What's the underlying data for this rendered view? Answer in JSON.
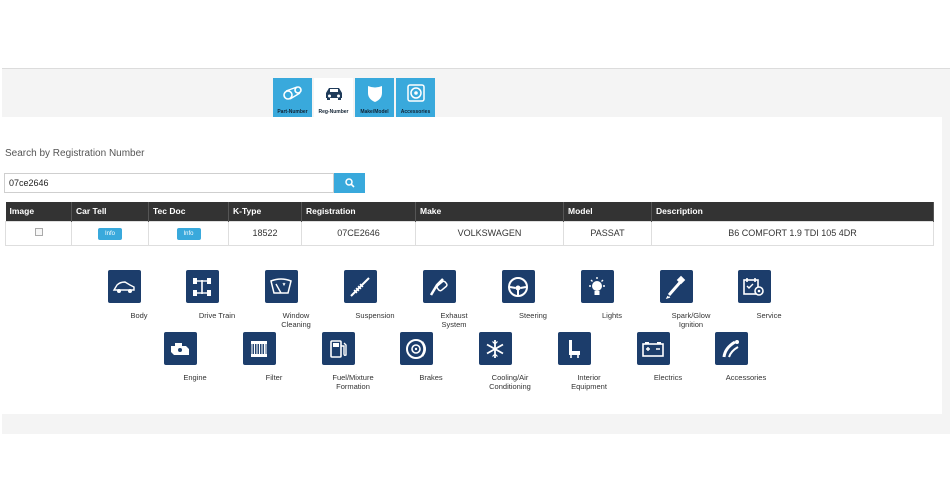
{
  "tabs": [
    {
      "label": "Part-Number",
      "icon": "belt-icon",
      "active": false
    },
    {
      "label": "Reg-Number",
      "icon": "car-icon",
      "active": true
    },
    {
      "label": "Make/Model",
      "icon": "shield-icon",
      "active": false
    },
    {
      "label": "Accessories",
      "icon": "speaker-icon",
      "active": false
    }
  ],
  "search": {
    "title": "Search by Registration Number",
    "value": "07ce2646",
    "button_icon": "search-icon"
  },
  "table": {
    "headers": [
      "Image",
      "Car Tell",
      "Tec Doc",
      "K-Type",
      "Registration",
      "Make",
      "Model",
      "Description"
    ],
    "row": {
      "cartell_btn": "Info",
      "tecdoc_btn": "Info",
      "ktype": "18522",
      "registration": "07CE2646",
      "make": "VOLKSWAGEN",
      "model": "PASSAT",
      "description": "B6 COMFORT 1.9 TDI 105 4DR"
    }
  },
  "categories_row1": [
    {
      "label": "Body",
      "icon": "car-body-icon"
    },
    {
      "label": "Drive Train",
      "icon": "axle-icon"
    },
    {
      "label": "Window Cleaning",
      "icon": "windscreen-icon"
    },
    {
      "label": "Suspension",
      "icon": "shock-absorber-icon"
    },
    {
      "label": "Exhaust System",
      "icon": "exhaust-icon"
    },
    {
      "label": "Steering",
      "icon": "steering-wheel-icon"
    },
    {
      "label": "Lights",
      "icon": "bulb-icon"
    },
    {
      "label": "Spark/Glow Ignition",
      "icon": "spark-plug-icon"
    },
    {
      "label": "Service",
      "icon": "service-icon"
    }
  ],
  "categories_row2": [
    {
      "label": "Engine",
      "icon": "engine-icon"
    },
    {
      "label": "Filter",
      "icon": "filter-icon"
    },
    {
      "label": "Fuel/Mixture Formation",
      "icon": "fuel-pump-icon"
    },
    {
      "label": "Brakes",
      "icon": "brake-disc-icon"
    },
    {
      "label": "Cooling/Air Conditioning",
      "icon": "snowflake-icon"
    },
    {
      "label": "Interior Equipment",
      "icon": "seat-icon"
    },
    {
      "label": "Electrics",
      "icon": "battery-icon"
    },
    {
      "label": "Accessories",
      "icon": "accessories-icon"
    }
  ],
  "colors": {
    "accent": "#39a9dc",
    "icon_bg": "#1c3d6b",
    "table_header": "#333333"
  }
}
